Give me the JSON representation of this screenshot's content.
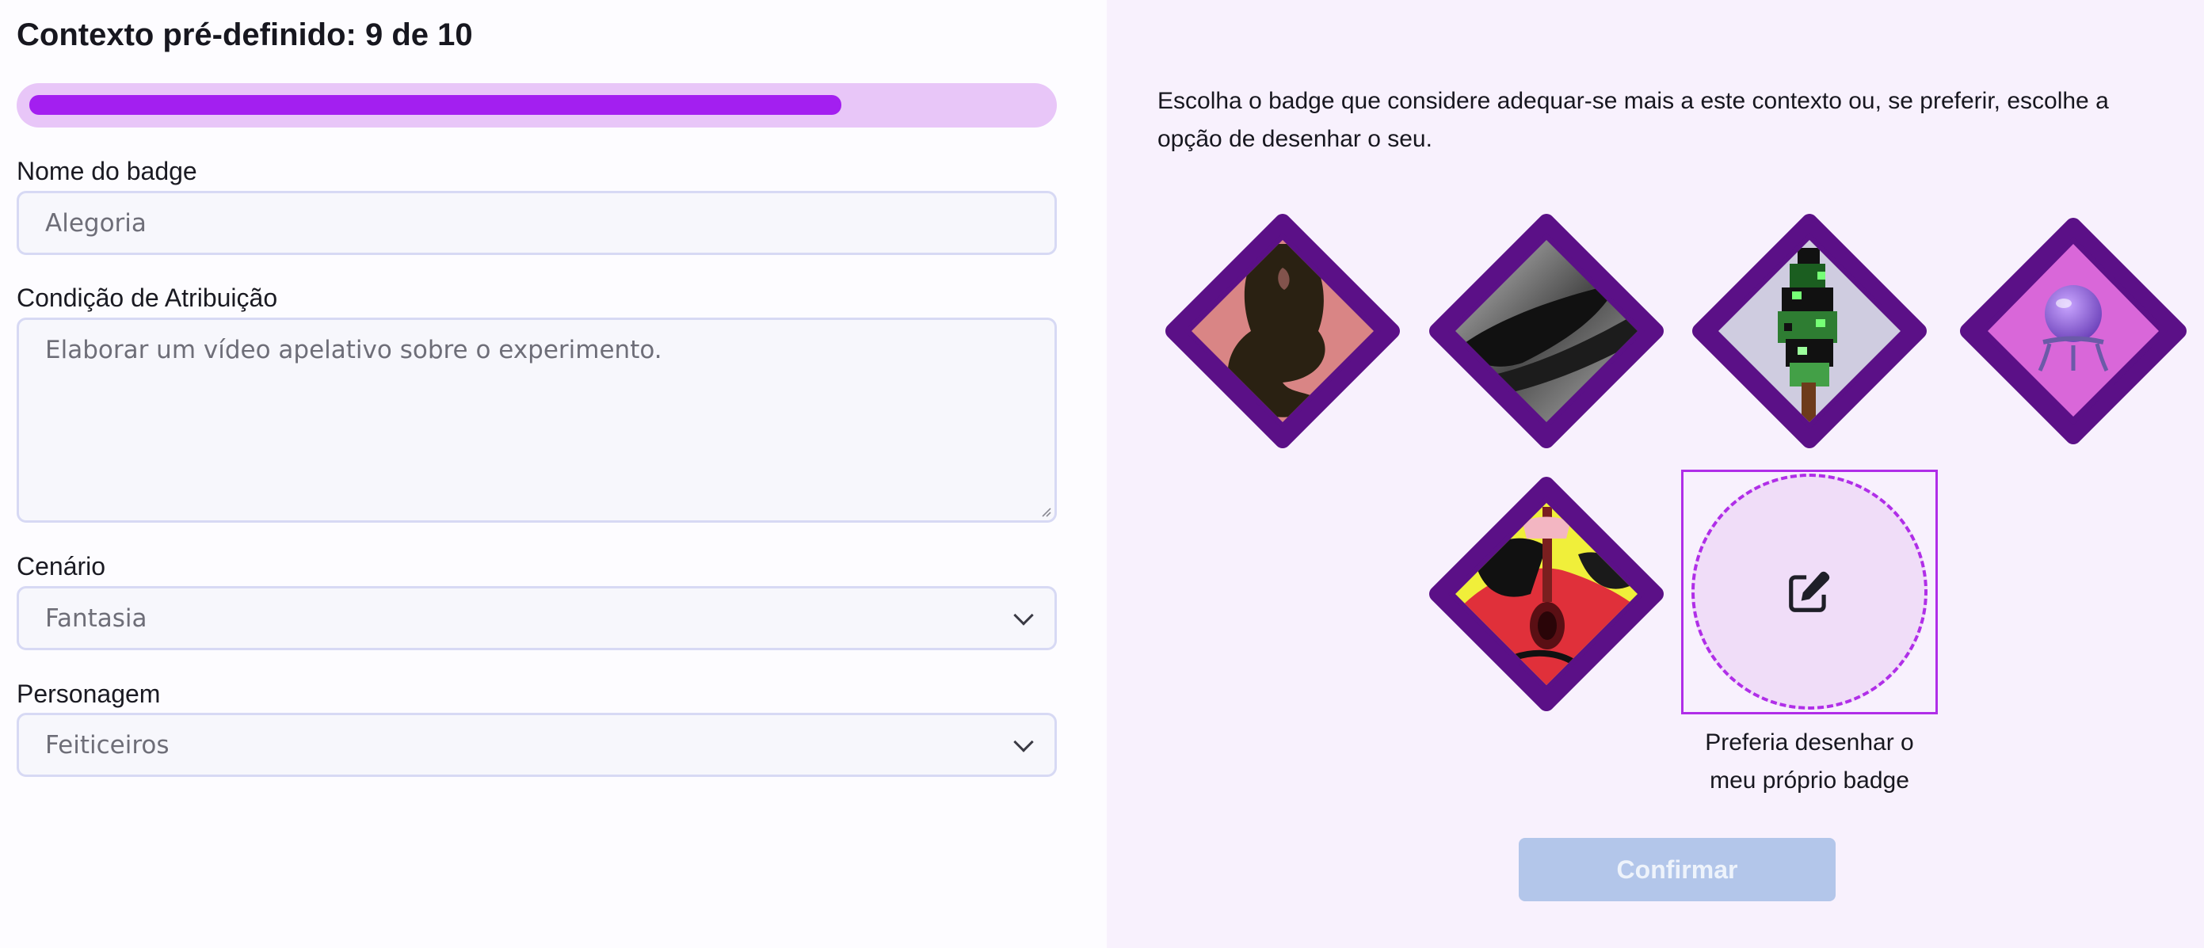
{
  "header": {
    "title": "Contexto pré-definido: 9 de 10"
  },
  "progress": {
    "current": 9,
    "total": 10,
    "fraction": 0.8
  },
  "form": {
    "badge_name_label": "Nome do badge",
    "badge_name_value": "Alegoria",
    "condition_label": "Condição de Atribuição",
    "condition_value": "Elaborar um vídeo apelativo sobre o experimento.",
    "scenario_label": "Cenário",
    "scenario_value": "Fantasia",
    "character_label": "Personagem",
    "character_value": "Feiticeiros"
  },
  "selection": {
    "instructions": "Escolha o badge que considere adequar-se mais a este contexto ou, se preferir, escolhe a opção de desenhar o seu.",
    "badges": [
      {
        "icon": "silhouette-badge-icon"
      },
      {
        "icon": "wizard-hat-badge-icon"
      },
      {
        "icon": "pixel-tree-badge-icon"
      },
      {
        "icon": "crystal-ball-badge-icon"
      },
      {
        "icon": "red-guitar-badge-icon"
      }
    ],
    "draw_option": {
      "caption": "Preferia desenhar o meu próprio badge",
      "icon": "edit-icon"
    },
    "confirm_label": "Confirmar"
  },
  "colors": {
    "accent": "#a31ff0",
    "badge_frame": "#5b1087",
    "confirm_disabled": "#b3c6ea"
  }
}
